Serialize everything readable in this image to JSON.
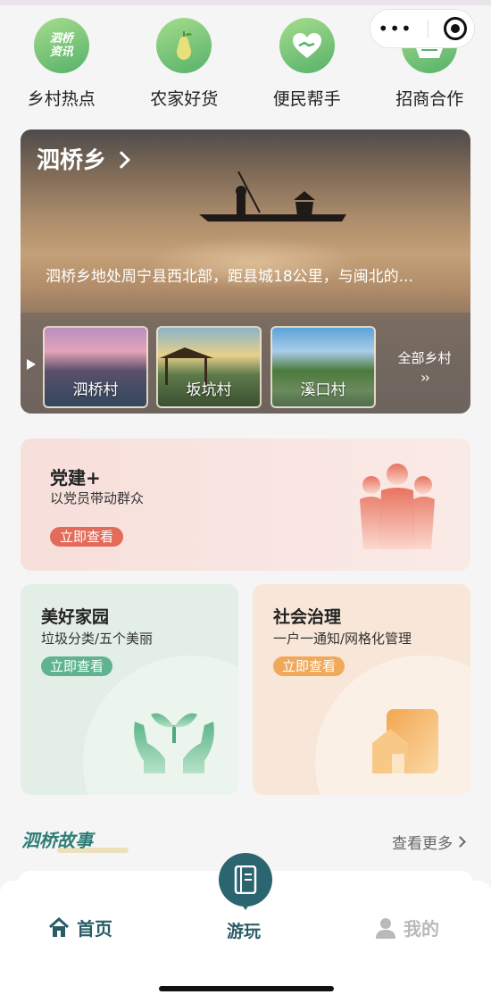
{
  "categories": [
    {
      "label": "乡村热点",
      "icon": "news-badge-icon",
      "icon_text": "泗桥 资讯"
    },
    {
      "label": "农家好货",
      "icon": "pear-icon"
    },
    {
      "label": "便民帮手",
      "icon": "heart-hand-icon"
    },
    {
      "label": "招商合作",
      "icon": "handshake-basket-icon"
    }
  ],
  "hero": {
    "title": "泗桥乡",
    "description": "泗桥乡地处周宁县西北部，距县城18公里，与闽北的...",
    "villages": [
      "泗桥村",
      "坂坑村",
      "溪口村"
    ],
    "all_label": "全部乡村",
    "all_arrow": "››"
  },
  "party": {
    "title": "党建+",
    "subtitle": "以党员带动群众",
    "button": "立即查看"
  },
  "beauty": {
    "title": "美好家园",
    "subtitle": "垃圾分类/五个美丽",
    "button": "立即查看"
  },
  "governance": {
    "title": "社会治理",
    "subtitle": "一户一通知/网格化管理",
    "button": "立即查看"
  },
  "stories": {
    "title": "泗桥故事",
    "more": "查看更多"
  },
  "tabbar": {
    "home": "首页",
    "play": "游玩",
    "mine": "我的"
  },
  "colors": {
    "accent": "#2b6570",
    "green": "#5fb390",
    "orange": "#f0a85a",
    "red": "#e36b59"
  }
}
